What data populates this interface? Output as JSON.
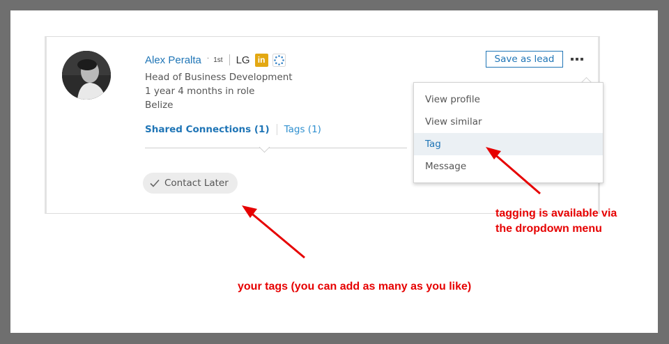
{
  "profile": {
    "name": "Alex Peralta",
    "dot": "·",
    "degree": "1st",
    "company_abbr": "LG",
    "linkedin_badge": "in",
    "title": "Head of Business Development",
    "tenure": "1 year 4 months in role",
    "location": "Belize"
  },
  "tabs": {
    "shared_connections": "Shared Connections (1)",
    "tags": "Tags (1)"
  },
  "tag_pill": {
    "label": "Contact Later",
    "icon": "check-icon"
  },
  "actions": {
    "save_label": "Save as lead",
    "more_icon": "more-icon"
  },
  "menu": {
    "items": [
      {
        "label": "View profile"
      },
      {
        "label": "View similar"
      },
      {
        "label": "Tag",
        "highlighted": true
      },
      {
        "label": "Message"
      }
    ]
  },
  "annotations": {
    "right_line1": "tagging is available via",
    "right_line2": "the dropdown menu",
    "bottom": "your tags (you can add as many as you like)"
  },
  "colors": {
    "link": "#1f75b6",
    "annotation": "#e60000",
    "badge": "#e3a812",
    "frame": "#6f6f6f"
  }
}
